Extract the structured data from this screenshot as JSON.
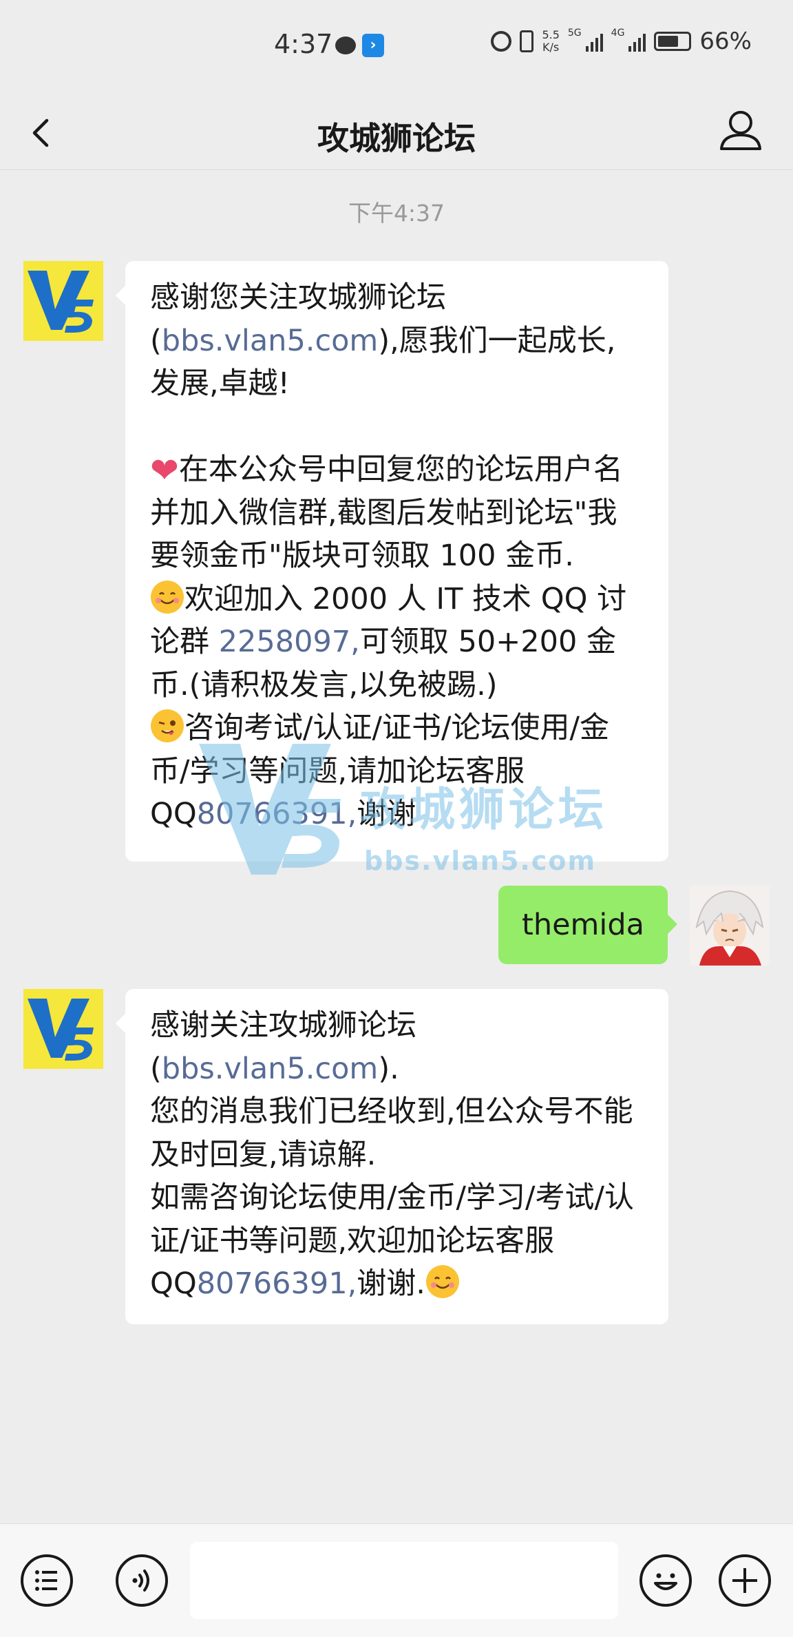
{
  "status_bar": {
    "time": "4:37",
    "speed_value": "5.5",
    "speed_unit": "K/s",
    "net_a": "5G",
    "net_b": "4G",
    "battery": "66%",
    "app_icon_glyph": "›"
  },
  "nav": {
    "title": "攻城狮论坛",
    "back_icon": "chevron-left-icon",
    "profile_icon": "person-icon"
  },
  "timestamp": "下午4:37",
  "messages": [
    {
      "from": "bot",
      "avatar_text": "V5",
      "paragraphs": [
        {
          "pre": "感谢您关注攻城狮论坛(",
          "link": "bbs.vlan5.com",
          "post": "),愿我们一起成长,发展,卓越!"
        },
        {
          "emoji": "heart-emoji",
          "text": "在本公众号中回复您的论坛用户名并加入微信群,截图后发帖到论坛\"我要领金币\"版块可领取 100 金币."
        },
        {
          "emoji": "smile-emoji",
          "pre": "欢迎加入 2000 人 IT 技术 QQ 讨论群 ",
          "link": "2258097,",
          "post": "可领取 50+200 金币.(请积极发言,以免被踢.)"
        },
        {
          "emoji": "wink-emoji",
          "pre": "咨询考试/认证/证书/论坛使用/金币/学习等问题,请加论坛客服QQ",
          "link": "80766391,",
          "post": "谢谢"
        }
      ]
    },
    {
      "from": "user",
      "text": "themida"
    },
    {
      "from": "bot",
      "avatar_text": "V5",
      "paragraphs": [
        {
          "pre": "感谢关注攻城狮论坛(",
          "link": "bbs.vlan5.com",
          "post": ")."
        },
        {
          "text": "您的消息我们已经收到,但公众号不能及时回复,请谅解."
        },
        {
          "pre": "如需咨询论坛使用/金币/学习/考试/认证/证书等问题,欢迎加论坛客服 QQ",
          "link": "80766391,",
          "post": "谢谢."
        }
      ]
    }
  ],
  "watermark": {
    "text": "攻城狮论坛",
    "url": "bbs.vlan5.com"
  },
  "input_bar": {
    "menu_icon": "list-menu-icon",
    "voice_icon": "voice-icon",
    "input_value": "",
    "emoji_icon": "emoji-icon",
    "add_icon": "plus-icon"
  },
  "colors": {
    "background": "#ededed",
    "bubble_in": "#ffffff",
    "bubble_out": "#95ec69",
    "link": "#576b95",
    "watermark": "#7cc1e8",
    "avatar_bg": "#f5e73b"
  }
}
